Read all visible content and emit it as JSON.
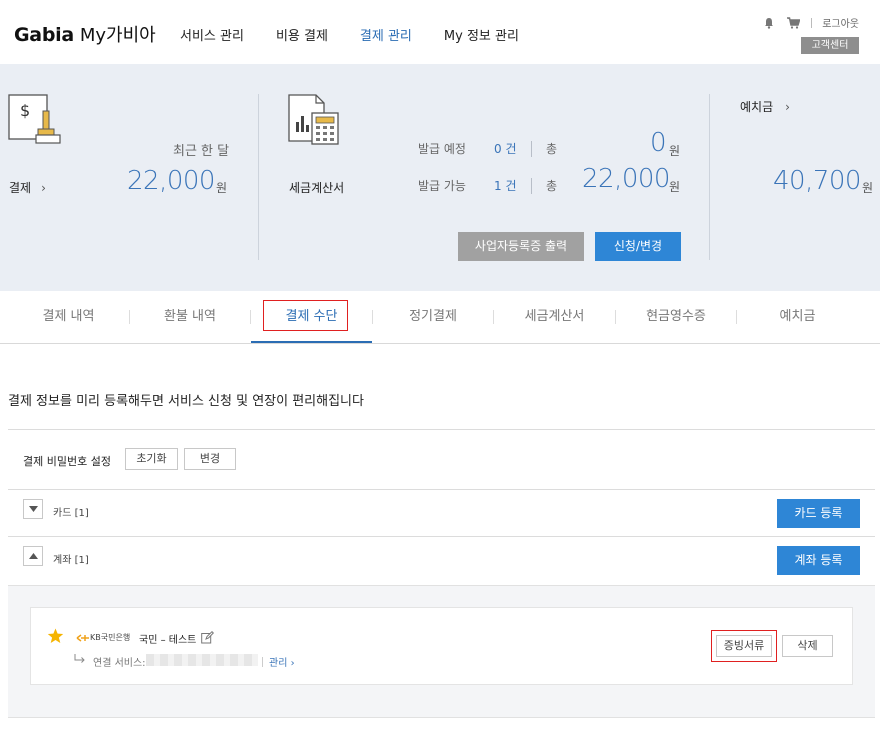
{
  "header": {
    "logo_brand": "Gabia",
    "logo_sub": "My가비아",
    "nav": [
      "서비스 관리",
      "비용 결제",
      "결제 관리",
      "My 정보 관리"
    ],
    "active_nav": "결제 관리",
    "logout": "로그아웃",
    "customer_center": "고객센터"
  },
  "summary": {
    "payment_label": "결제",
    "recent_month_label": "최근 한 달",
    "recent_amount": "22,000",
    "won": "원",
    "tax_invoice_label": "세금계산서",
    "issue_scheduled": "발급 예정",
    "issue_scheduled_count": "0 건",
    "issue_available": "발급 가능",
    "issue_available_count": "1 건",
    "total": "총",
    "scheduled_total": "0",
    "available_total": "22,000",
    "print_business_cert": "사업자등록증 출력",
    "apply_change": "신청/변경",
    "deposit_label": "예치금",
    "deposit_amount": "40,700"
  },
  "tabs": [
    "결제 내역",
    "환불 내역",
    "결제 수단",
    "정기결제",
    "세금계산서",
    "현금영수증",
    "예치금"
  ],
  "active_tab": "결제 수단",
  "content": {
    "intro": "결제 정보를 미리 등록해두면 서비스 신청 및 연장이 편리해집니다",
    "password_label": "결제 비밀번호 설정",
    "reset": "초기화",
    "change": "변경",
    "card_row": "카드 [1]",
    "card_register": "카드 등록",
    "account_row": "계좌 [1]",
    "account_register": "계좌 등록",
    "account": {
      "bank": "KB국민은행",
      "name": "국민 – 테스트",
      "linked_service_label": "연결 서비스:",
      "manage": "관리 ›",
      "proof_docs": "증빙서류",
      "delete": "삭제"
    }
  },
  "colors": {
    "accent": "#2e86d6",
    "highlight_box": "#e02020",
    "band_bg": "#eaeef4"
  }
}
